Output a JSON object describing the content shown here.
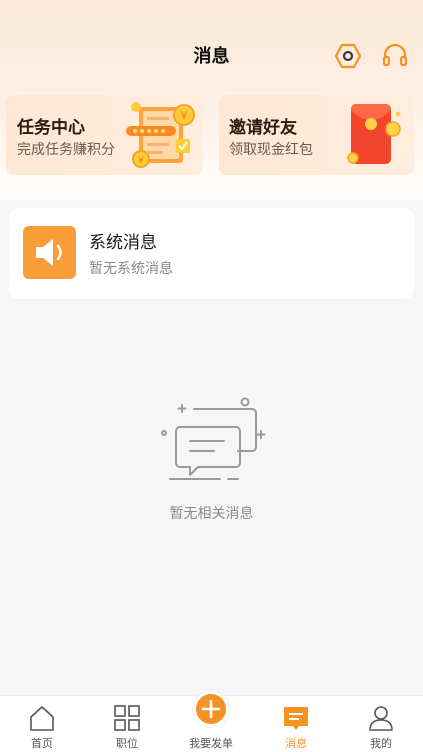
{
  "header": {
    "title": "消息"
  },
  "promos": [
    {
      "title": "任务中心",
      "subtitle": "完成任务赚积分"
    },
    {
      "title": "邀请好友",
      "subtitle": "领取现金红包"
    }
  ],
  "system_message": {
    "title": "系统消息",
    "subtitle": "暂无系统消息"
  },
  "empty_state": {
    "text": "暂无相关消息"
  },
  "tabs": [
    {
      "label": "首页",
      "icon": "home-icon"
    },
    {
      "label": "职位",
      "icon": "grid-icon"
    },
    {
      "label": "我要发单",
      "icon": "plus-icon"
    },
    {
      "label": "消息",
      "icon": "message-icon"
    },
    {
      "label": "我的",
      "icon": "user-icon"
    }
  ],
  "active_tab": "消息",
  "colors": {
    "accent": "#f39324",
    "system_icon_bg": "#f99d39",
    "promo_bg": "#ffe9d6"
  }
}
